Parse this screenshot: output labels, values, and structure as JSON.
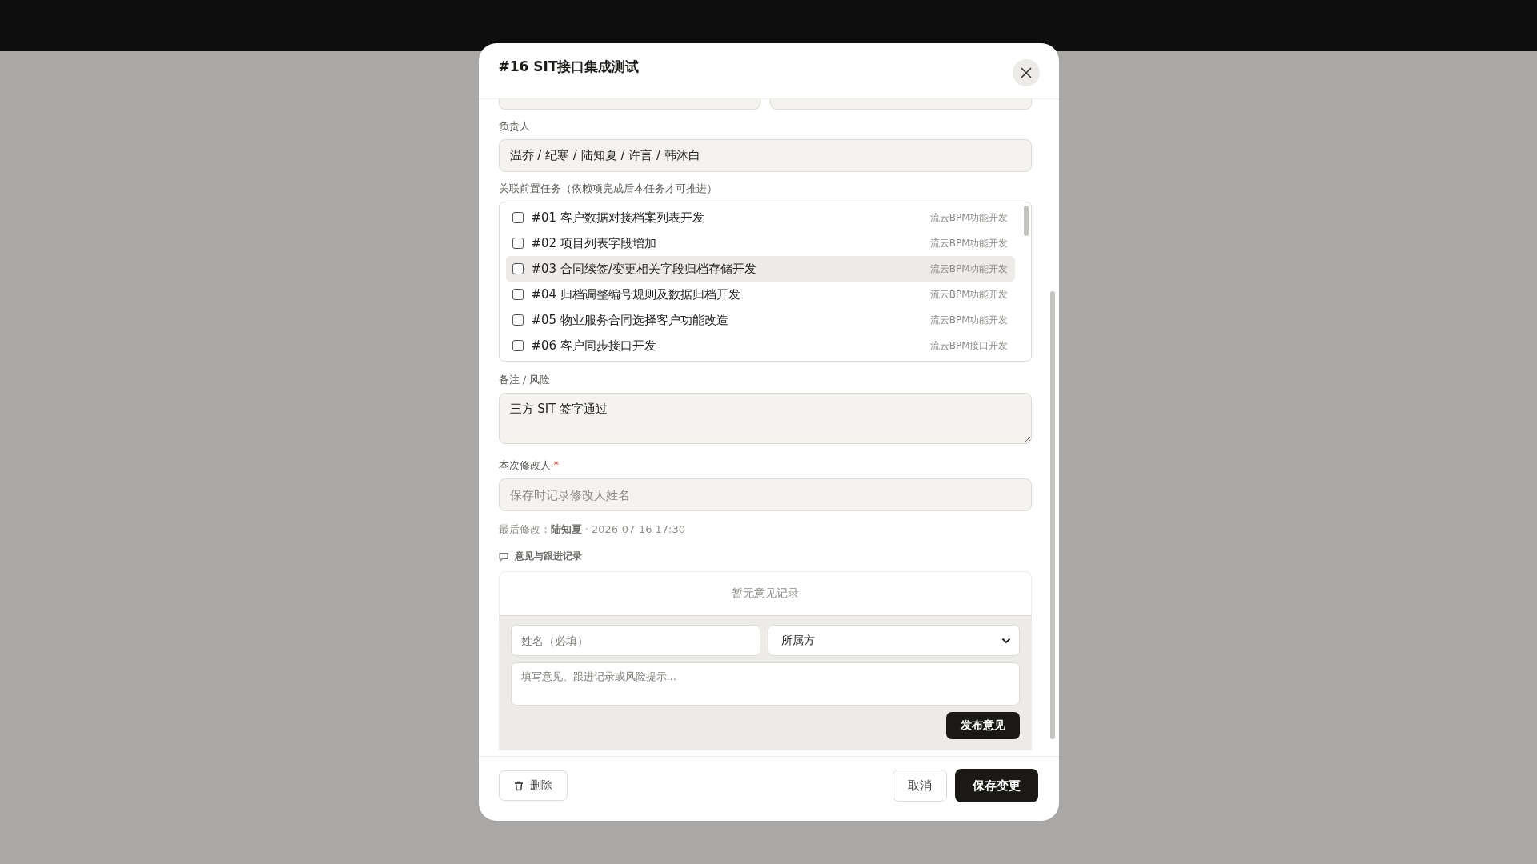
{
  "dialog": {
    "title": "#16 SIT接口集成测试"
  },
  "owner": {
    "label": "负责人",
    "value": "温乔 / 纪寒 / 陆知夏 / 许言 / 韩沐白"
  },
  "dependencies": {
    "label": "关联前置任务（依赖项完成后本任务才可推进）",
    "items": [
      {
        "title": "#01 客户数据对接档案列表开发",
        "tag": "流云BPM功能开发",
        "checked": false,
        "highlighted": false
      },
      {
        "title": "#02 项目列表字段增加",
        "tag": "流云BPM功能开发",
        "checked": false,
        "highlighted": false
      },
      {
        "title": "#03 合同续签/变更相关字段归档存储开发",
        "tag": "流云BPM功能开发",
        "checked": false,
        "highlighted": true
      },
      {
        "title": "#04 归档调整编号规则及数据归档开发",
        "tag": "流云BPM功能开发",
        "checked": false,
        "highlighted": false
      },
      {
        "title": "#05 物业服务合同选择客户功能改造",
        "tag": "流云BPM功能开发",
        "checked": false,
        "highlighted": false
      },
      {
        "title": "#06 客户同步接口开发",
        "tag": "流云BPM接口开发",
        "checked": false,
        "highlighted": false
      }
    ]
  },
  "notes": {
    "label": "备注 / 风险",
    "value": "三方 SIT 签字通过"
  },
  "editor": {
    "label": "本次修改人",
    "required_mark": "*",
    "placeholder": "保存时记录修改人姓名"
  },
  "last_modified": {
    "label": "最后修改：",
    "name": "陆知夏",
    "time": "· 2026-07-16 17:30"
  },
  "comments": {
    "title": "意见与跟进记录",
    "empty": "暂无意见记录",
    "name_placeholder": "姓名（必填）",
    "party_select": "所属方",
    "text_placeholder": "填写意见、跟进记录或风险提示...",
    "submit": "发布意见"
  },
  "footer": {
    "delete": "删除",
    "cancel": "取消",
    "save": "保存变更"
  }
}
